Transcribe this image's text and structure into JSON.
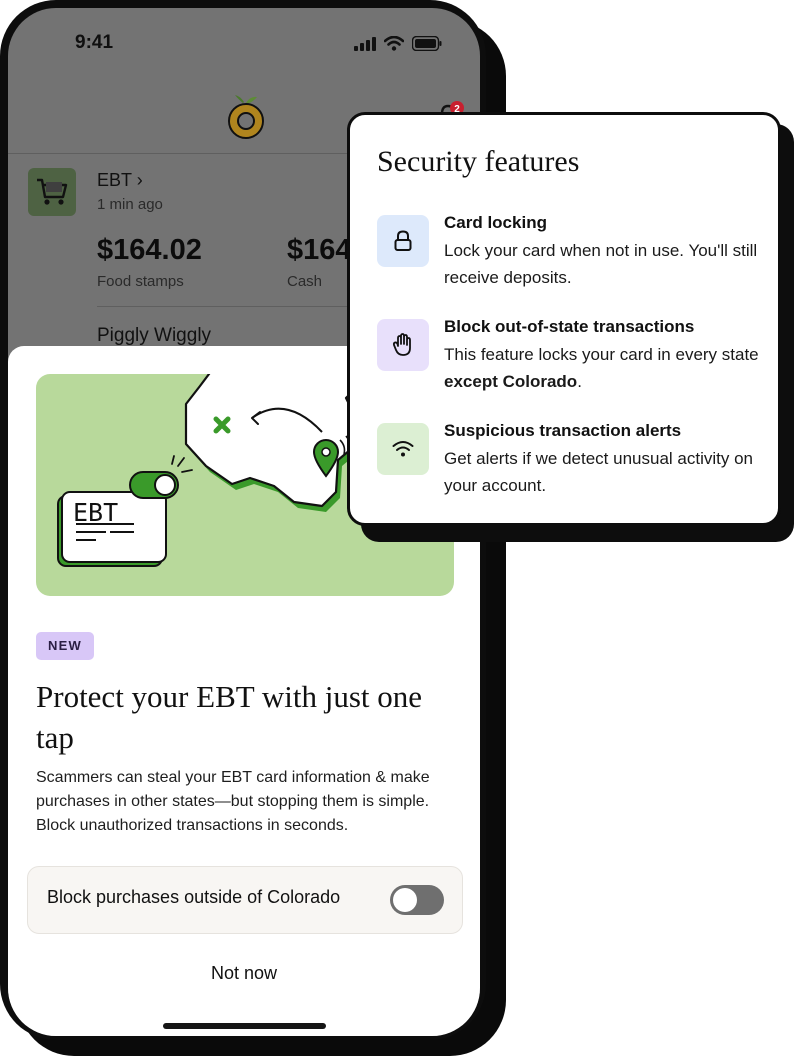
{
  "status_bar": {
    "time": "9:41"
  },
  "notifications": {
    "count": "2"
  },
  "account": {
    "title": "EBT",
    "chevron": "›",
    "updated": "1 min ago",
    "balances": [
      {
        "amount": "$164.02",
        "label": "Food stamps"
      },
      {
        "amount": "$164",
        "label": "Cash"
      }
    ],
    "last_merchant": "Piggly Wiggly"
  },
  "sheet": {
    "illustration": {
      "card_text": "EBT"
    },
    "badge": "NEW",
    "headline": "Protect your EBT with just one tap",
    "body": "Scammers can steal your EBT card information & make purchases in other states—but stopping them is simple. Block unauthorized transactions in seconds.",
    "toggle_label": "Block purchases outside of Colorado",
    "toggle_on": false,
    "dismiss_label": "Not now"
  },
  "security_card": {
    "title": "Security features",
    "features": [
      {
        "icon": "lock-icon",
        "icon_bg": "#dde9fb",
        "title": "Card locking",
        "desc_before": "Lock your card when not in use. You'll still receive deposits.",
        "desc_bold": "",
        "desc_after": ""
      },
      {
        "icon": "hand-icon",
        "icon_bg": "#e8e0fb",
        "title": "Block out-of-state transactions",
        "desc_before": "This feature locks your card in every state ",
        "desc_bold": "except Colorado",
        "desc_after": "."
      },
      {
        "icon": "wifi-alert-icon",
        "icon_bg": "#dcefd3",
        "title": "Suspicious transaction alerts",
        "desc_before": "Get alerts if we detect unusual activity on your account.",
        "desc_bold": "",
        "desc_after": ""
      }
    ]
  },
  "colors": {
    "accent_green": "#3a9a2a",
    "illustration_bg": "#b8d99b",
    "badge_bg": "#d8c7f7",
    "overlay_gray": "#737373",
    "notification_red": "#c8202f"
  }
}
